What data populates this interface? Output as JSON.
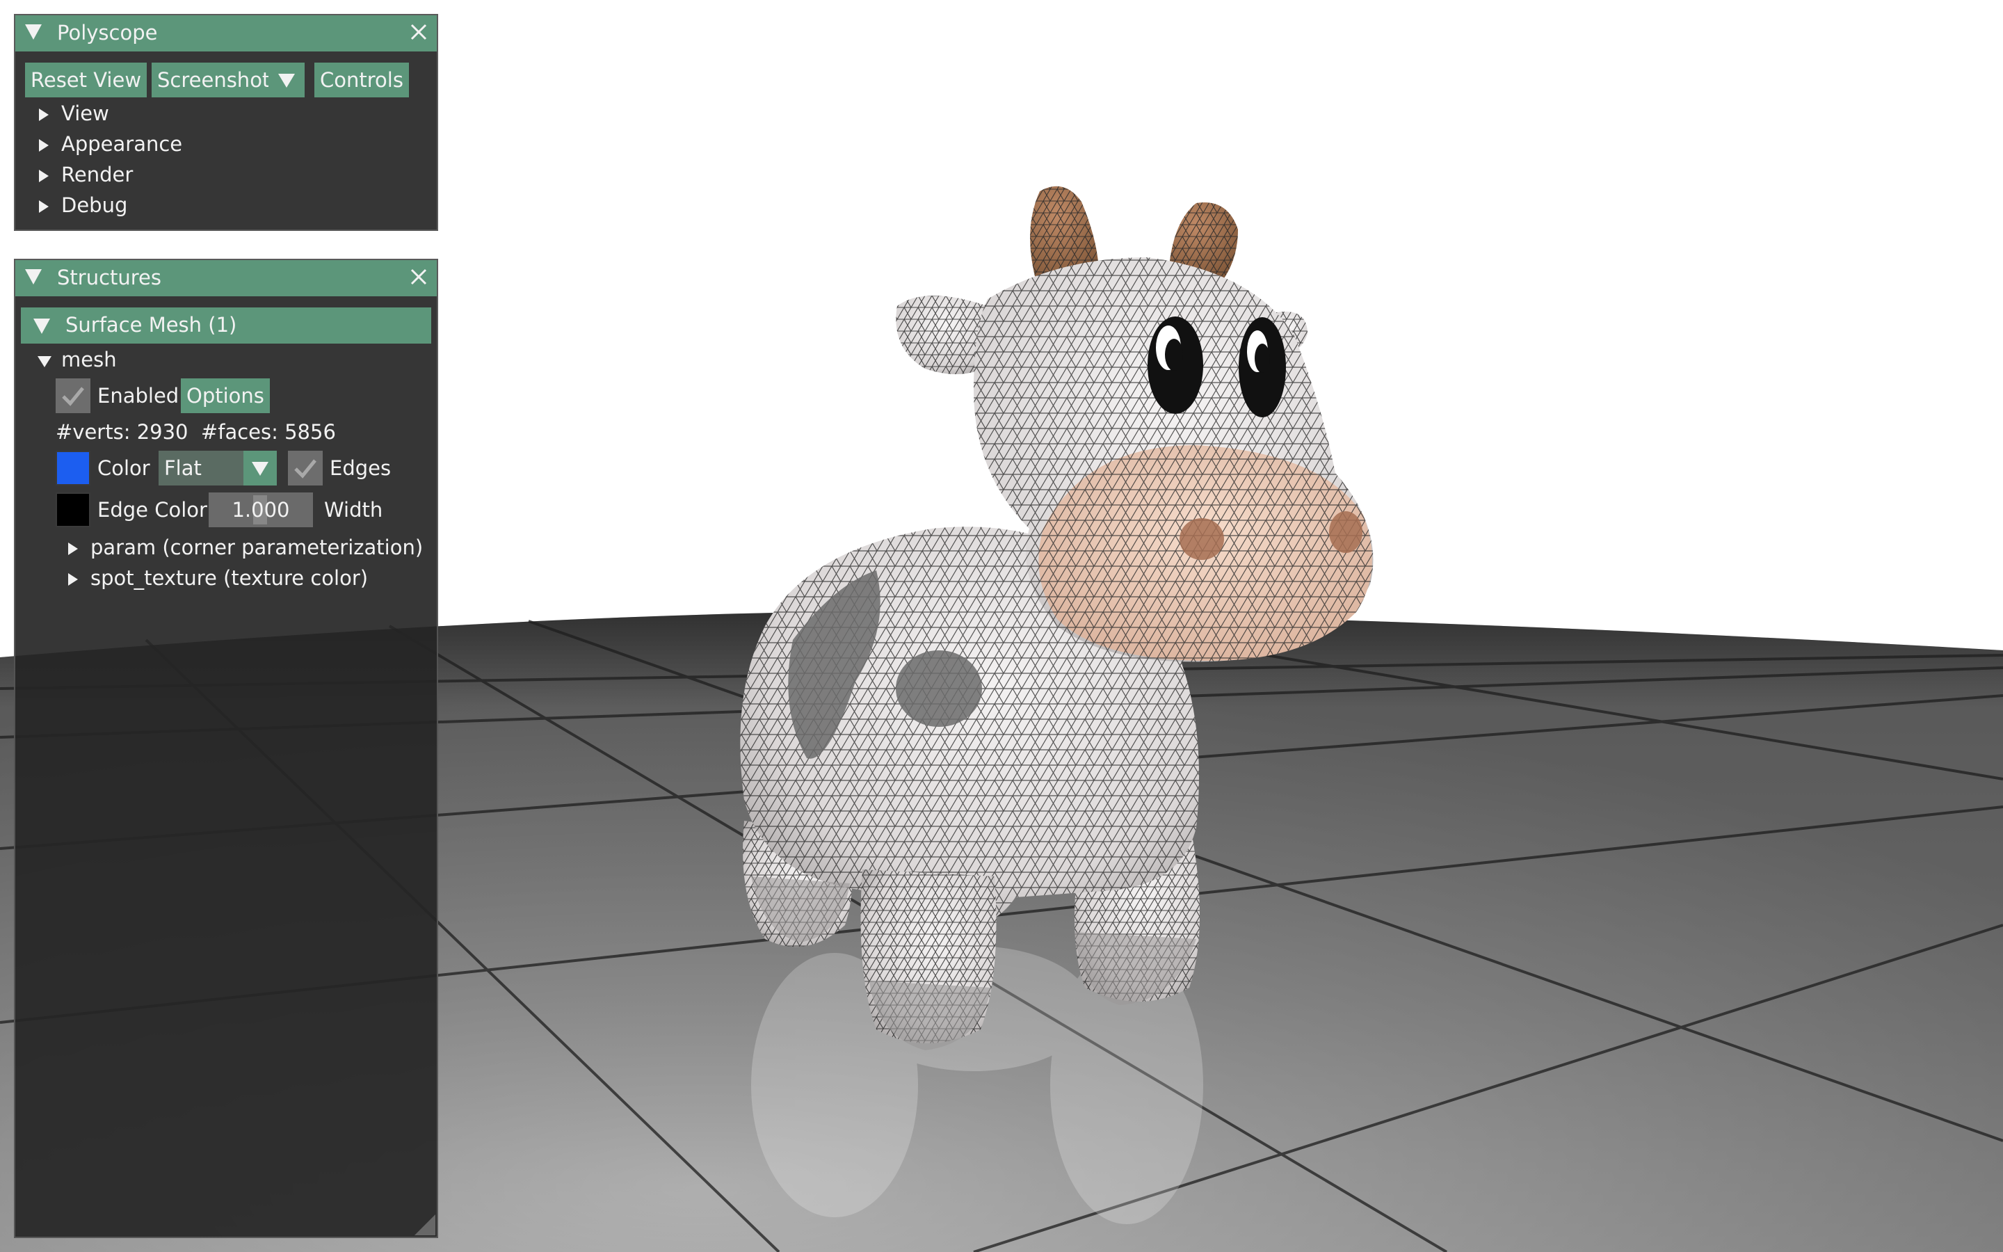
{
  "theme": {
    "accent": "#5c967a",
    "panel_bg": "#252525",
    "mesh_color": "#1c5ef0",
    "edge_color": "#000000"
  },
  "polyscope_panel": {
    "title": "Polyscope",
    "buttons": {
      "reset_view": "Reset View",
      "screenshot": "Screenshot",
      "controls": "Controls"
    },
    "menu": [
      "View",
      "Appearance",
      "Render",
      "Debug"
    ]
  },
  "structures_panel": {
    "title": "Structures",
    "group_header": "Surface Mesh (1)",
    "mesh": {
      "name": "mesh",
      "enabled": true,
      "enabled_label": "Enabled",
      "options_label": "Options",
      "stats": "#verts: 2930  #faces: 5856",
      "color_label": "Color",
      "shading_value": "Flat",
      "edges_checked": true,
      "edges_label": "Edges",
      "edge_color_label": "Edge Color",
      "edge_width_value": "1.000",
      "width_label": "Width",
      "quantities": [
        "param (corner parameterization)",
        "spot_texture (texture color)"
      ]
    }
  },
  "viewport": {
    "object": "mesh",
    "ground": "tiled-floor"
  }
}
